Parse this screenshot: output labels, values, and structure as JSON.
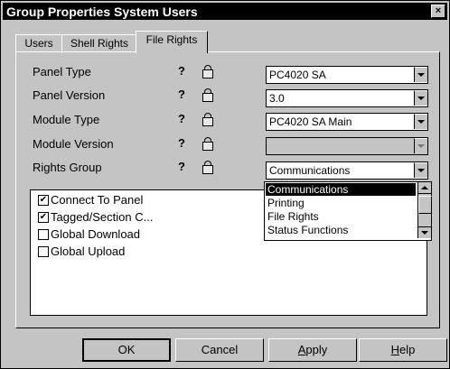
{
  "window": {
    "title": "Group Properties System Users",
    "close_label": "×"
  },
  "tabs": [
    {
      "label": "Users",
      "active": false
    },
    {
      "label": "Shell Rights",
      "active": false
    },
    {
      "label": "File Rights",
      "active": true
    }
  ],
  "fields": [
    {
      "label": "Panel Type",
      "value": "PC4020 SA",
      "disabled": false
    },
    {
      "label": "Panel Version",
      "value": "3.0",
      "disabled": false
    },
    {
      "label": "Module Type",
      "value": "PC4020 SA Main",
      "disabled": false
    },
    {
      "label": "Module Version",
      "value": "",
      "disabled": true
    },
    {
      "label": "Rights Group",
      "value": "Communications",
      "disabled": false
    }
  ],
  "key_glyph": "?",
  "icons": {
    "key": "key-icon",
    "lock": "lock-icon",
    "check": "checkbox",
    "arrow": "chevron-down-icon"
  },
  "dropdown": {
    "options": [
      "Communications",
      "Printing",
      "File Rights",
      "Status Functions"
    ],
    "selected": "Communications"
  },
  "rights": [
    {
      "label": "Connect To Panel",
      "checked": true,
      "mark": "✔"
    },
    {
      "label": "Tagged/Section C...",
      "checked": true,
      "mark": "✔"
    },
    {
      "label": "Global Download",
      "checked": false,
      "mark": ""
    },
    {
      "label": "Global Upload",
      "checked": false,
      "mark": ""
    }
  ],
  "buttons": {
    "ok": "OK",
    "cancel": "Cancel",
    "apply_first": "A",
    "apply_rest": "pply",
    "help_first": "H",
    "help_rest": "elp"
  }
}
